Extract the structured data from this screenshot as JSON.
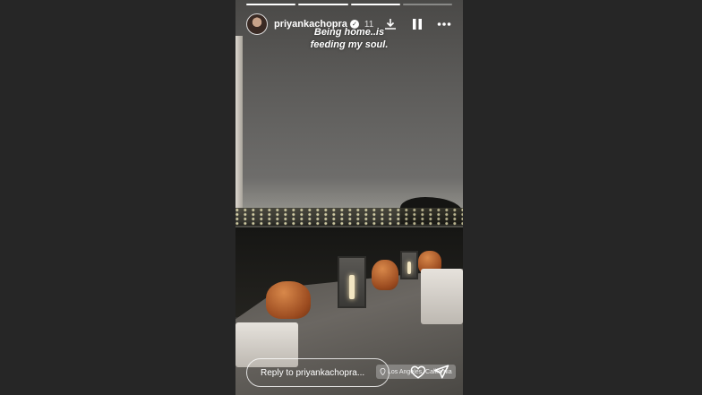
{
  "story": {
    "username": "priyankachopra",
    "time_ago": "11",
    "caption_line1": "Being home..is",
    "caption_line2": "feeding my soul.",
    "progress_segments": 4,
    "progress_completed": 3
  },
  "icons": {
    "download": "download-icon",
    "pause": "pause-icon",
    "more": "more-icon",
    "verified": "verified-badge-icon",
    "heart": "heart-icon",
    "send": "send-icon",
    "location": "location-pin-icon"
  },
  "footer": {
    "reply_placeholder": "Reply to priyankachopra...",
    "location_text": "Los Angeles, California"
  }
}
